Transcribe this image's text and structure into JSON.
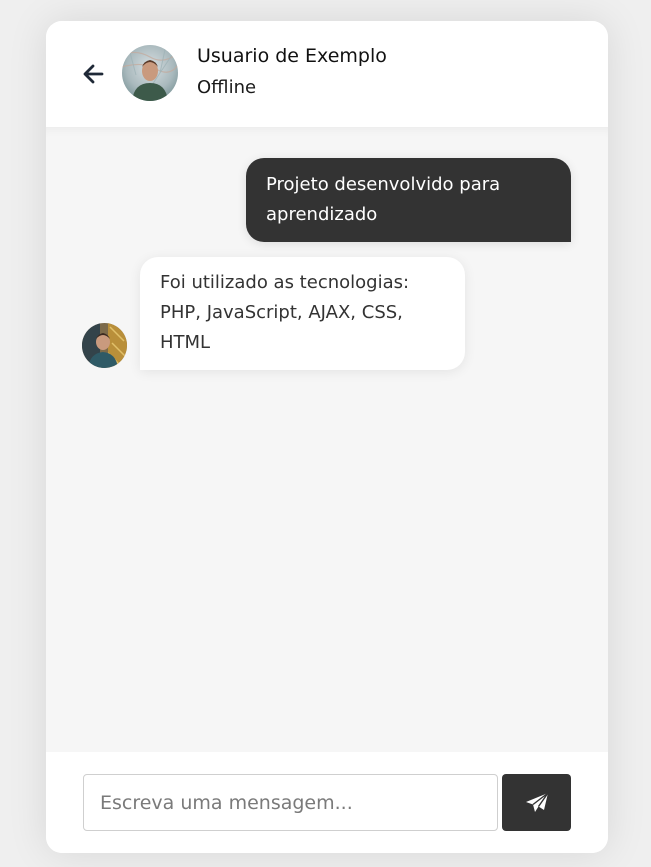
{
  "header": {
    "back_icon": "arrow-left-icon",
    "user_name": "Usuario de Exemplo",
    "status": "Offline",
    "avatar": "user-avatar"
  },
  "messages": [
    {
      "direction": "outgoing",
      "text": "Projeto desenvolvido para aprendizado"
    },
    {
      "direction": "incoming",
      "text": "Foi utilizado as tecnologias: PHP, JavaScript, AJAX, CSS, HTML",
      "avatar": "user-avatar"
    }
  ],
  "composer": {
    "placeholder": "Escreva uma mensagem...",
    "value": "",
    "send_icon": "paper-plane-icon"
  },
  "colors": {
    "page_bg": "#efefef",
    "chat_bg": "#f6f6f6",
    "outgoing_bubble": "#333333",
    "incoming_bubble": "#ffffff",
    "send_button": "#333333"
  }
}
